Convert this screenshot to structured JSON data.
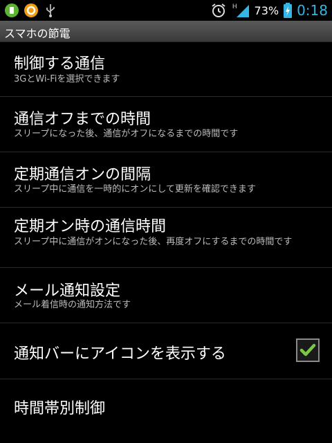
{
  "statusbar": {
    "battery_percent": "73%",
    "time": "0:18",
    "icons": [
      "green-app-icon",
      "orange-app-icon",
      "usb-icon",
      "alarm-icon",
      "signal-icon",
      "battery-icon"
    ],
    "network_label": "H"
  },
  "titlebar": {
    "title": "スマホの節電"
  },
  "settings": [
    {
      "title": "制御する通信",
      "summary": "3GとWi-Fiを選択できます"
    },
    {
      "title": "通信オフまでの時間",
      "summary": "スリープになった後、通信がオフになるまでの時間です"
    },
    {
      "title": "定期通信オンの間隔",
      "summary": "スリープ中に通信を一時的にオンにして更新を確認できます"
    },
    {
      "title": "定期オン時の通信時間",
      "summary": "スリープ中に通信がオンになった後、再度オフにするまでの時間です"
    },
    {
      "title": "メール通知設定",
      "summary": "メール着信時の通知方法です"
    },
    {
      "title": "通知バーにアイコンを表示する",
      "checked": true
    },
    {
      "title": "時間帯別制御"
    }
  ],
  "colors": {
    "accent": "#33b5e5",
    "check": "#7ac943"
  }
}
